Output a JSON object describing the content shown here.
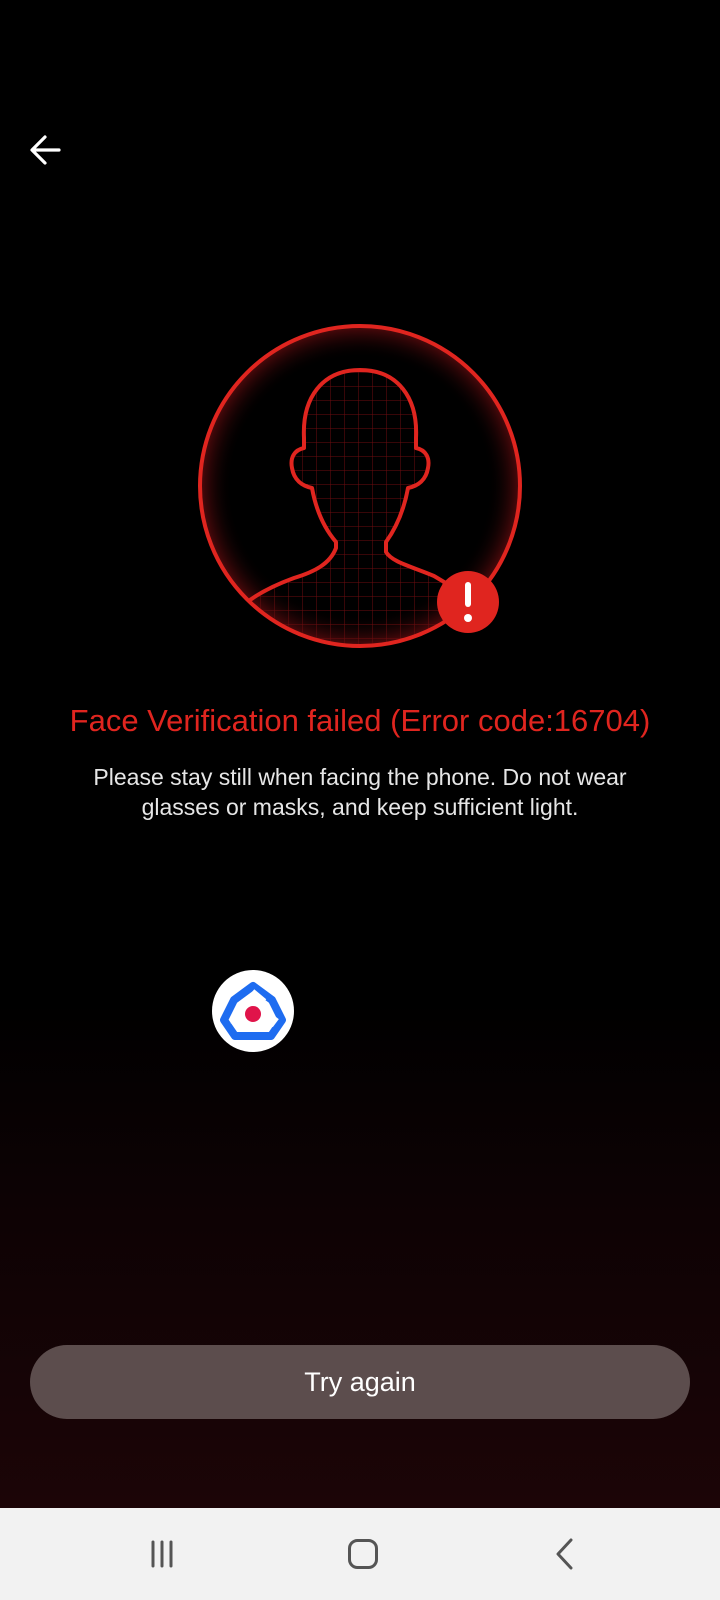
{
  "header": {
    "back_icon": "arrow-left-icon"
  },
  "face_graphic": {
    "icon": "face-silhouette-icon",
    "error_badge_icon": "exclamation-icon",
    "accent_color": "#e0251f"
  },
  "main": {
    "error_title": "Face Verification failed (Error code:16704)",
    "hint_line1": "Please stay still when facing the phone. Do not wear",
    "hint_line2": "glasses or masks, and keep sufficient light."
  },
  "app_logo": {
    "icon": "app-logo-icon"
  },
  "actions": {
    "try_again_label": "Try again"
  },
  "nav_bar": {
    "recent_icon": "recent-apps-icon",
    "home_icon": "home-icon",
    "back_icon": "back-chevron-icon"
  }
}
